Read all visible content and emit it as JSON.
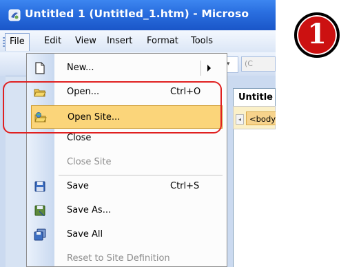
{
  "window": {
    "title": "Untitled 1 (Untitled_1.htm) - Microso"
  },
  "menubar": {
    "items": [
      "File",
      "Edit",
      "View",
      "Insert",
      "Format",
      "Tools"
    ]
  },
  "toolbar": {
    "combo2_text": "(C"
  },
  "document": {
    "tab_label": "Untitle",
    "tag_chip": "<body"
  },
  "file_menu": {
    "items": [
      {
        "label": "New...",
        "shortcut": "",
        "icon": "new-page-icon",
        "enabled": true,
        "submenu": true
      },
      {
        "label": "Open...",
        "shortcut": "Ctrl+O",
        "icon": "open-folder-icon",
        "enabled": true
      },
      {
        "label": "Open Site...",
        "shortcut": "",
        "icon": "open-site-icon",
        "enabled": true,
        "highlighted": true
      },
      {
        "label": "Close",
        "shortcut": "",
        "icon": "",
        "enabled": true
      },
      {
        "label": "Close Site",
        "shortcut": "",
        "icon": "",
        "enabled": false
      },
      {
        "label": "Save",
        "shortcut": "Ctrl+S",
        "icon": "save-icon",
        "enabled": true
      },
      {
        "label": "Save As...",
        "shortcut": "",
        "icon": "save-as-icon",
        "enabled": true
      },
      {
        "label": "Save All",
        "shortcut": "",
        "icon": "save-all-icon",
        "enabled": true
      },
      {
        "label": "Reset to Site Definition",
        "shortcut": "",
        "icon": "",
        "enabled": false
      }
    ]
  },
  "annotation": {
    "step_number": "1",
    "colors": {
      "highlight_box": "#e02020",
      "badge": "#cc1111"
    }
  },
  "colors": {
    "titlebar": "#2a6fe0",
    "menu_highlight": "#fbd57a",
    "menu_gutter": "#c9d9f0"
  }
}
